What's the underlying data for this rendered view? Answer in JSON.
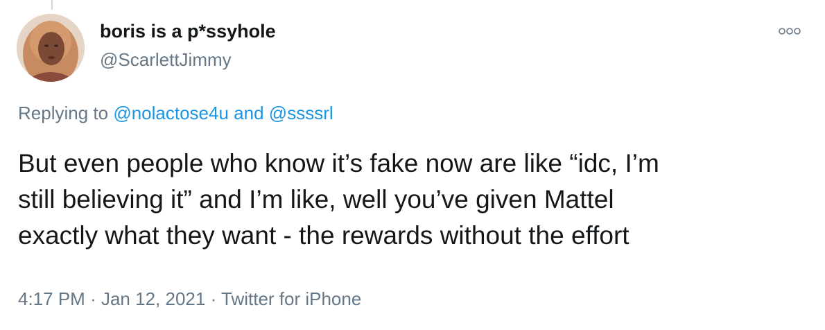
{
  "user": {
    "display_name": "boris is a p*ssyhole",
    "handle": "@ScarlettJimmy"
  },
  "reply_context": {
    "prefix": "Replying to",
    "mention_1": "@nolactose4u",
    "conjunction": "and",
    "mention_2": "@ssssrl"
  },
  "tweet": {
    "text": "But even people who know it’s fake now are like “idc, I’m\nstill believing it” and I’m like, well you’ve given Mattel\nexactly what they want - the rewards without the effort"
  },
  "meta": {
    "time": "4:17 PM",
    "separator": "·",
    "date": "Jan 12, 2021",
    "source": "Twitter for iPhone"
  },
  "icons": {
    "more": "more-options-icon",
    "avatar": "profile-photo"
  },
  "colors": {
    "link": "#1b95e0",
    "secondary_text": "#657786",
    "primary_text": "#14171a"
  }
}
